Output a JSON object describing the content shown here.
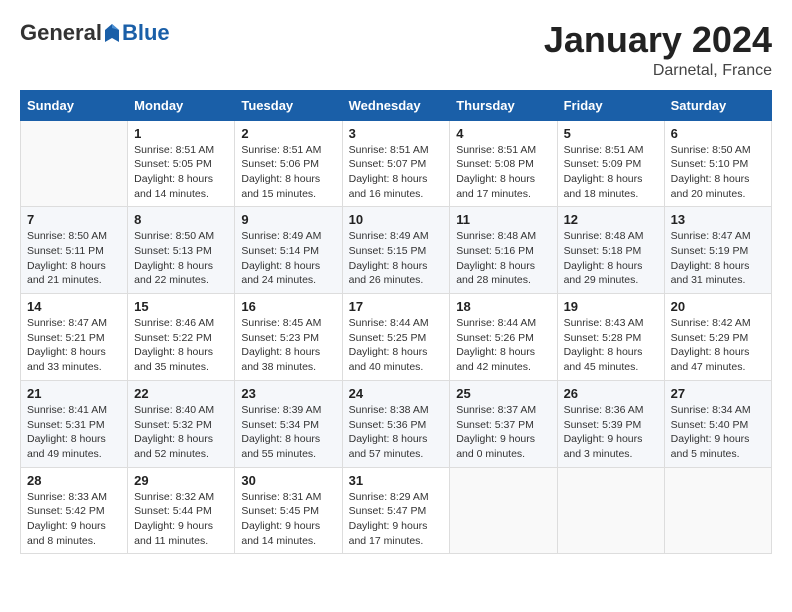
{
  "header": {
    "logo": {
      "general": "General",
      "blue": "Blue"
    },
    "title": "January 2024",
    "location": "Darnetal, France"
  },
  "calendar": {
    "days_of_week": [
      "Sunday",
      "Monday",
      "Tuesday",
      "Wednesday",
      "Thursday",
      "Friday",
      "Saturday"
    ],
    "weeks": [
      [
        {
          "day": "",
          "info": ""
        },
        {
          "day": "1",
          "info": "Sunrise: 8:51 AM\nSunset: 5:05 PM\nDaylight: 8 hours\nand 14 minutes."
        },
        {
          "day": "2",
          "info": "Sunrise: 8:51 AM\nSunset: 5:06 PM\nDaylight: 8 hours\nand 15 minutes."
        },
        {
          "day": "3",
          "info": "Sunrise: 8:51 AM\nSunset: 5:07 PM\nDaylight: 8 hours\nand 16 minutes."
        },
        {
          "day": "4",
          "info": "Sunrise: 8:51 AM\nSunset: 5:08 PM\nDaylight: 8 hours\nand 17 minutes."
        },
        {
          "day": "5",
          "info": "Sunrise: 8:51 AM\nSunset: 5:09 PM\nDaylight: 8 hours\nand 18 minutes."
        },
        {
          "day": "6",
          "info": "Sunrise: 8:50 AM\nSunset: 5:10 PM\nDaylight: 8 hours\nand 20 minutes."
        }
      ],
      [
        {
          "day": "7",
          "info": "Sunrise: 8:50 AM\nSunset: 5:11 PM\nDaylight: 8 hours\nand 21 minutes."
        },
        {
          "day": "8",
          "info": "Sunrise: 8:50 AM\nSunset: 5:13 PM\nDaylight: 8 hours\nand 22 minutes."
        },
        {
          "day": "9",
          "info": "Sunrise: 8:49 AM\nSunset: 5:14 PM\nDaylight: 8 hours\nand 24 minutes."
        },
        {
          "day": "10",
          "info": "Sunrise: 8:49 AM\nSunset: 5:15 PM\nDaylight: 8 hours\nand 26 minutes."
        },
        {
          "day": "11",
          "info": "Sunrise: 8:48 AM\nSunset: 5:16 PM\nDaylight: 8 hours\nand 28 minutes."
        },
        {
          "day": "12",
          "info": "Sunrise: 8:48 AM\nSunset: 5:18 PM\nDaylight: 8 hours\nand 29 minutes."
        },
        {
          "day": "13",
          "info": "Sunrise: 8:47 AM\nSunset: 5:19 PM\nDaylight: 8 hours\nand 31 minutes."
        }
      ],
      [
        {
          "day": "14",
          "info": "Sunrise: 8:47 AM\nSunset: 5:21 PM\nDaylight: 8 hours\nand 33 minutes."
        },
        {
          "day": "15",
          "info": "Sunrise: 8:46 AM\nSunset: 5:22 PM\nDaylight: 8 hours\nand 35 minutes."
        },
        {
          "day": "16",
          "info": "Sunrise: 8:45 AM\nSunset: 5:23 PM\nDaylight: 8 hours\nand 38 minutes."
        },
        {
          "day": "17",
          "info": "Sunrise: 8:44 AM\nSunset: 5:25 PM\nDaylight: 8 hours\nand 40 minutes."
        },
        {
          "day": "18",
          "info": "Sunrise: 8:44 AM\nSunset: 5:26 PM\nDaylight: 8 hours\nand 42 minutes."
        },
        {
          "day": "19",
          "info": "Sunrise: 8:43 AM\nSunset: 5:28 PM\nDaylight: 8 hours\nand 45 minutes."
        },
        {
          "day": "20",
          "info": "Sunrise: 8:42 AM\nSunset: 5:29 PM\nDaylight: 8 hours\nand 47 minutes."
        }
      ],
      [
        {
          "day": "21",
          "info": "Sunrise: 8:41 AM\nSunset: 5:31 PM\nDaylight: 8 hours\nand 49 minutes."
        },
        {
          "day": "22",
          "info": "Sunrise: 8:40 AM\nSunset: 5:32 PM\nDaylight: 8 hours\nand 52 minutes."
        },
        {
          "day": "23",
          "info": "Sunrise: 8:39 AM\nSunset: 5:34 PM\nDaylight: 8 hours\nand 55 minutes."
        },
        {
          "day": "24",
          "info": "Sunrise: 8:38 AM\nSunset: 5:36 PM\nDaylight: 8 hours\nand 57 minutes."
        },
        {
          "day": "25",
          "info": "Sunrise: 8:37 AM\nSunset: 5:37 PM\nDaylight: 9 hours\nand 0 minutes."
        },
        {
          "day": "26",
          "info": "Sunrise: 8:36 AM\nSunset: 5:39 PM\nDaylight: 9 hours\nand 3 minutes."
        },
        {
          "day": "27",
          "info": "Sunrise: 8:34 AM\nSunset: 5:40 PM\nDaylight: 9 hours\nand 5 minutes."
        }
      ],
      [
        {
          "day": "28",
          "info": "Sunrise: 8:33 AM\nSunset: 5:42 PM\nDaylight: 9 hours\nand 8 minutes."
        },
        {
          "day": "29",
          "info": "Sunrise: 8:32 AM\nSunset: 5:44 PM\nDaylight: 9 hours\nand 11 minutes."
        },
        {
          "day": "30",
          "info": "Sunrise: 8:31 AM\nSunset: 5:45 PM\nDaylight: 9 hours\nand 14 minutes."
        },
        {
          "day": "31",
          "info": "Sunrise: 8:29 AM\nSunset: 5:47 PM\nDaylight: 9 hours\nand 17 minutes."
        },
        {
          "day": "",
          "info": ""
        },
        {
          "day": "",
          "info": ""
        },
        {
          "day": "",
          "info": ""
        }
      ]
    ]
  }
}
